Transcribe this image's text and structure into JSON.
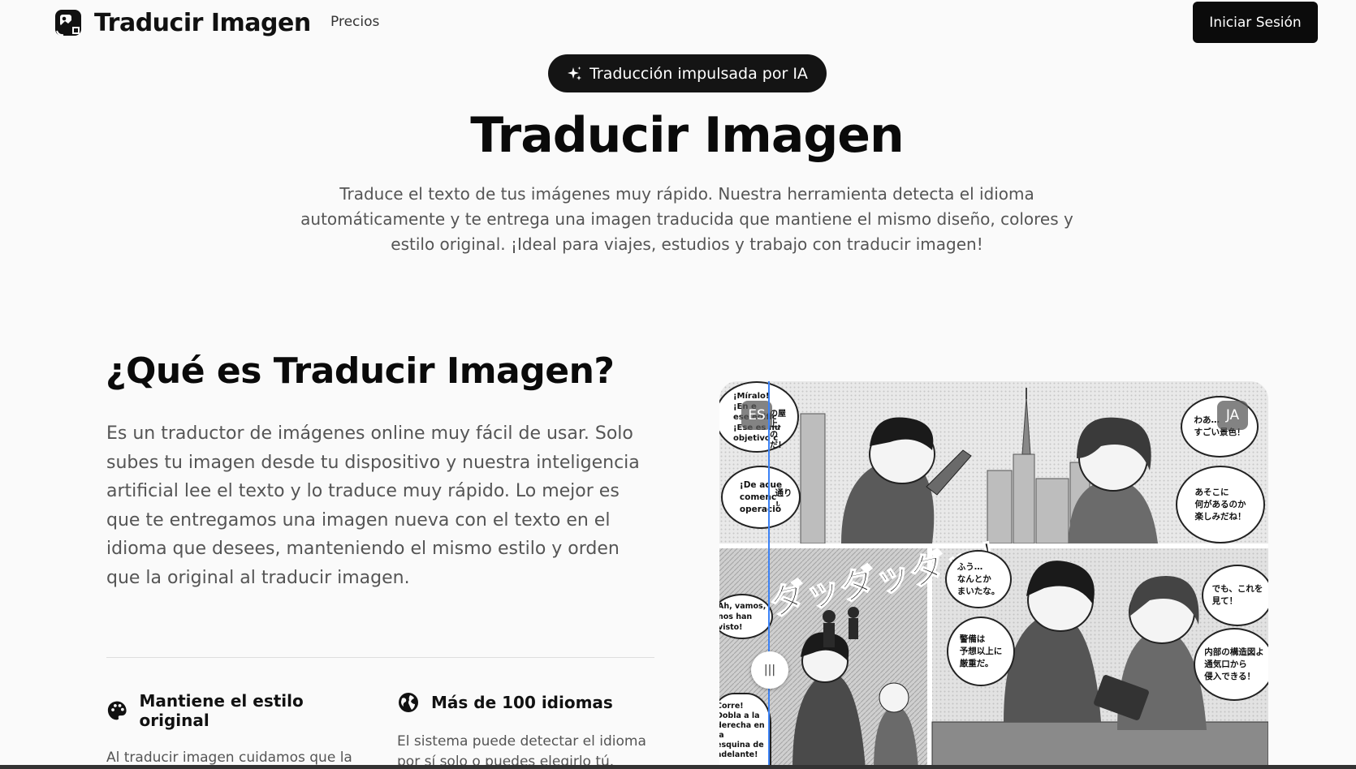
{
  "nav": {
    "brand": "Traducir Imagen",
    "links": [
      "Precios"
    ],
    "login": "Iniciar Sesión"
  },
  "hero": {
    "badge": "Traducción impulsada por IA",
    "title": "Traducir Imagen",
    "description": "Traduce el texto de tus imágenes muy rápido. Nuestra herramienta detecta el idioma automáticamente y te entrega una imagen traducida que mantiene el mismo diseño, colores y estilo original. ¡Ideal para viajes, estudios y trabajo con traducir imagen!"
  },
  "about": {
    "title": "¿Qué es Traducir Imagen?",
    "body": "Es un traductor de imágenes online muy fácil de usar. Solo subes tu imagen desde tu dispositivo y nuestra inteligencia artificial lee el texto y lo traduce muy rápido. Lo mejor es que te entregamos una imagen nueva con el texto en el idioma que desees, manteniendo el mismo estilo y orden que la original al traducir imagen.",
    "features": [
      {
        "title": "Mantiene el estilo original",
        "text": "Al traducir imagen cuidamos que la letra, los colores y el orden de los",
        "icon": "palette-icon"
      },
      {
        "title": "Más de 100 idiomas",
        "text": "El sistema puede detectar el idioma por sí solo o puedes elegirlo tú.",
        "icon": "globe-icon"
      }
    ]
  },
  "comparison": {
    "left_label": "ES",
    "right_label": "JA",
    "handle": "|||",
    "bubbles": {
      "es_1": "¡Míralo!\n¡En e\nese edific\n¡Ese es nu\nobjetivo c",
      "ja_1": "の屋上、\nの\nだ！",
      "es_2": "¡De acue\ncomenc\noperació",
      "ja_2": "通り\n！",
      "ja_3": "わあ…\nすごい景色！",
      "ja_4": "あそこに\n何があるのか\n楽しみだね！",
      "ja_5": "ふう…\nなんとか\nまいたな。",
      "ja_6": "警備は\n予想以上に\n厳重だ。",
      "ja_7": "でも、これを\n見て！",
      "ja_8": "内部の構造図よ\n通気口から\n侵入できる！",
      "es_3": "Ah, vamos,\nnos han visto!",
      "es_4": "Corre!\nDobla a la\nderecha en la\nesquina de\nadelante!",
      "sfx": "ダッダッダッ！"
    }
  }
}
